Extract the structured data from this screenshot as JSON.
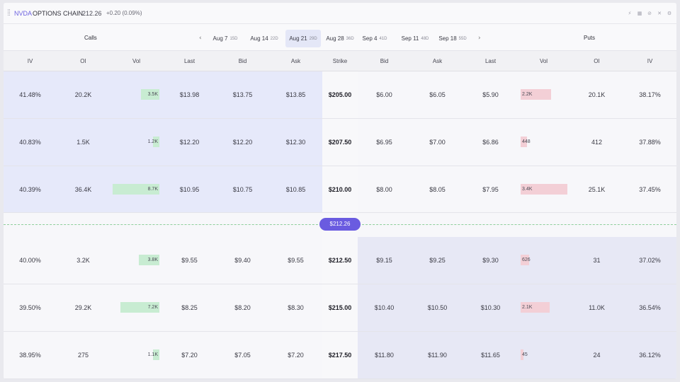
{
  "header": {
    "ticker": "NVDA",
    "title": "OPTIONS CHAIN",
    "price": "212.26",
    "change": "+0.20 (0.09%)",
    "tool_icons": [
      "lightning-icon",
      "calculator-icon",
      "link-icon",
      "expand-icon",
      "gear-icon"
    ]
  },
  "expiries": {
    "calls_label": "Calls",
    "puts_label": "Puts",
    "prev_arrow": "‹",
    "next_arrow": "›",
    "items": [
      {
        "date": "Aug 7",
        "days": "15D",
        "selected": false
      },
      {
        "date": "Aug 14",
        "days": "22D",
        "selected": false
      },
      {
        "date": "Aug 21",
        "days": "29D",
        "selected": true
      },
      {
        "date": "Aug 28",
        "days": "36D",
        "selected": false
      },
      {
        "date": "Sep 4",
        "days": "41D",
        "selected": false
      },
      {
        "date": "Sep 11",
        "days": "48D",
        "selected": false
      },
      {
        "date": "Sep 18",
        "days": "55D",
        "selected": false
      }
    ]
  },
  "columns": {
    "calls": [
      "IV",
      "OI",
      "Vol",
      "Last",
      "Bid",
      "Ask"
    ],
    "strike": "Strike",
    "puts": [
      "Bid",
      "Ask",
      "Last",
      "Vol",
      "OI",
      "IV"
    ]
  },
  "spot_label": "$212.26",
  "colors": {
    "accent": "#6a5be0",
    "call_vol_bar": "#c8ecd2",
    "put_vol_bar": "#f3cfd6",
    "call_itm_bg": "#e6e9fa",
    "put_itm_bg": "#e7e8f5"
  },
  "rows": [
    {
      "strike": "$205.00",
      "call": {
        "iv": "41.48%",
        "oi": "20.2K",
        "vol": "3.5K",
        "vol_fraction": 0.4,
        "last": "$13.98",
        "bid": "$13.75",
        "ask": "$13.85"
      },
      "put": {
        "bid": "$6.00",
        "ask": "$6.05",
        "last": "$5.90",
        "vol": "2.2K",
        "vol_fraction": 0.65,
        "oi": "20.1K",
        "iv": "38.17%"
      }
    },
    {
      "strike": "$207.50",
      "call": {
        "iv": "40.83%",
        "oi": "1.5K",
        "vol": "1.2K",
        "vol_fraction": 0.14,
        "last": "$12.20",
        "bid": "$12.20",
        "ask": "$12.30"
      },
      "put": {
        "bid": "$6.95",
        "ask": "$7.00",
        "last": "$6.86",
        "vol": "448",
        "vol_fraction": 0.13,
        "oi": "412",
        "iv": "37.88%"
      }
    },
    {
      "strike": "$210.00",
      "call": {
        "iv": "40.39%",
        "oi": "36.4K",
        "vol": "8.7K",
        "vol_fraction": 1.0,
        "last": "$10.95",
        "bid": "$10.75",
        "ask": "$10.85"
      },
      "put": {
        "bid": "$8.00",
        "ask": "$8.05",
        "last": "$7.95",
        "vol": "3.4K",
        "vol_fraction": 1.0,
        "oi": "25.1K",
        "iv": "37.45%"
      }
    },
    {
      "strike": "$212.50",
      "call": {
        "iv": "40.00%",
        "oi": "3.2K",
        "vol": "3.8K",
        "vol_fraction": 0.44,
        "last": "$9.55",
        "bid": "$9.40",
        "ask": "$9.55"
      },
      "put": {
        "bid": "$9.15",
        "ask": "$9.25",
        "last": "$9.30",
        "vol": "626",
        "vol_fraction": 0.18,
        "oi": "31",
        "iv": "37.02%"
      }
    },
    {
      "strike": "$215.00",
      "call": {
        "iv": "39.50%",
        "oi": "29.2K",
        "vol": "7.2K",
        "vol_fraction": 0.83,
        "last": "$8.25",
        "bid": "$8.20",
        "ask": "$8.30"
      },
      "put": {
        "bid": "$10.40",
        "ask": "$10.50",
        "last": "$10.30",
        "vol": "2.1K",
        "vol_fraction": 0.62,
        "oi": "11.0K",
        "iv": "36.54%"
      }
    },
    {
      "strike": "$217.50",
      "call": {
        "iv": "38.95%",
        "oi": "275",
        "vol": "1.1K",
        "vol_fraction": 0.13,
        "last": "$7.20",
        "bid": "$7.05",
        "ask": "$7.20"
      },
      "put": {
        "bid": "$11.80",
        "ask": "$11.90",
        "last": "$11.65",
        "vol": "45",
        "vol_fraction": 0.02,
        "oi": "24",
        "iv": "36.12%"
      }
    }
  ]
}
